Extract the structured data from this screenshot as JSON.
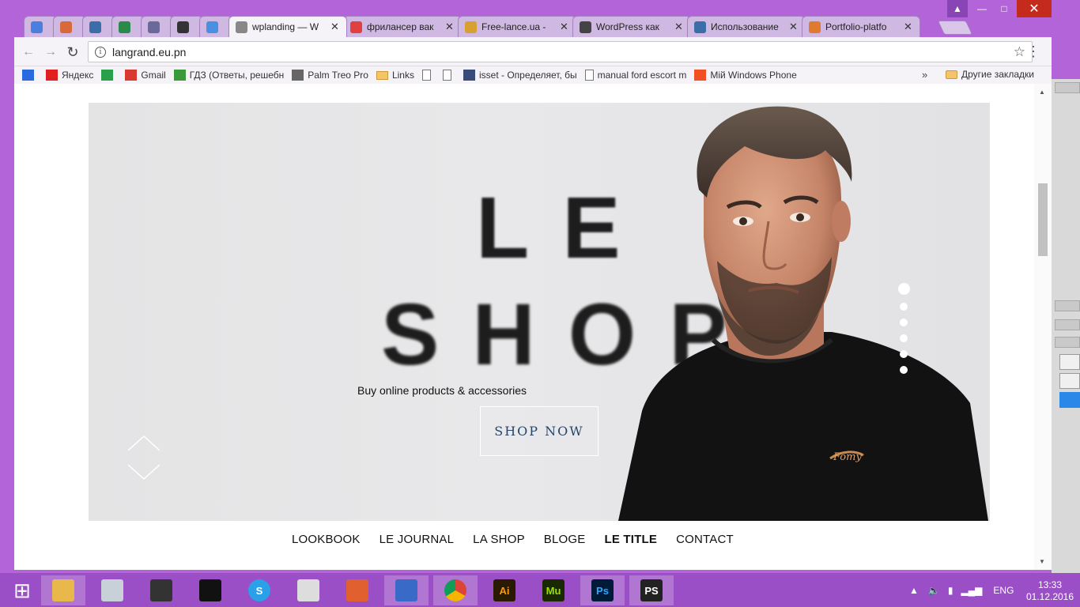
{
  "window": {
    "controls": {
      "user": "▲",
      "minimize": "—",
      "maximize": "□",
      "close": "✕"
    }
  },
  "tabs": [
    {
      "title": "",
      "icon": "google-translate-icon",
      "color": "#4a7fe0"
    },
    {
      "title": "",
      "icon": "app-icon",
      "color": "#d86a3a"
    },
    {
      "title": "",
      "icon": "chart-icon",
      "color": "#3a6ea8"
    },
    {
      "title": "",
      "icon": "f-icon",
      "color": "#2a8a4a"
    },
    {
      "title": "",
      "icon": "tool-icon",
      "color": "#6a6a9a"
    },
    {
      "title": "",
      "icon": "play-icon",
      "color": "#333"
    },
    {
      "title": "",
      "icon": "dashboard-icon",
      "color": "#4a90e2"
    },
    {
      "title": "wplanding — W",
      "icon": "wplanding-icon",
      "color": "#888"
    },
    {
      "title": "фрилансер вак",
      "icon": "yandex-icon",
      "color": "#e04040"
    },
    {
      "title": "Free-lance.ua -",
      "icon": "freelance-icon",
      "color": "#d8a030"
    },
    {
      "title": "WordPress как",
      "icon": "wordpress-icon",
      "color": "#444"
    },
    {
      "title": "Использование",
      "icon": "jb-icon",
      "color": "#3a6ea8"
    },
    {
      "title": "Portfolio-platfo",
      "icon": "portfolio-icon",
      "color": "#e07a30"
    }
  ],
  "toolbar": {
    "back": "←",
    "forward": "→",
    "reload": "↻",
    "url": "langrand.eu.pn",
    "star": "☆",
    "menu": "⋮"
  },
  "bookmarks": [
    {
      "label": "",
      "icon": "mail-icon"
    },
    {
      "label": "Яндекс",
      "icon": "yandex-icon"
    },
    {
      "label": "",
      "icon": "green-mail-icon"
    },
    {
      "label": "Gmail",
      "icon": "gmail-icon"
    },
    {
      "label": "ГДЗ (Ответы, решебн",
      "icon": "gdz-icon"
    },
    {
      "label": "Palm Treo Pro",
      "icon": "cart-icon"
    },
    {
      "label": "Links",
      "icon": "folder-icon"
    },
    {
      "label": "",
      "icon": "page-icon"
    },
    {
      "label": "",
      "icon": "page-icon"
    },
    {
      "label": "isset - Определяет, бы",
      "icon": "php-icon"
    },
    {
      "label": "manual ford escort m",
      "icon": "page-icon"
    },
    {
      "label": "Мій Windows Phone",
      "icon": "windows-icon"
    }
  ],
  "bookmarks_more": "»",
  "bookmarks_other": "Другие закладки",
  "hero": {
    "title_line1": "LE",
    "title_line2": "SHOP",
    "subtitle": "Buy online products & accessories",
    "cta": "SHOP NOW",
    "slides_total": 6,
    "slide_active": 1
  },
  "site_nav": [
    {
      "label": "LOOKBOOK",
      "bold": false
    },
    {
      "label": "LE JOURNAL",
      "bold": false
    },
    {
      "label": "LA SHOP",
      "bold": false
    },
    {
      "label": "BLOGE",
      "bold": false
    },
    {
      "label": "LE TITLE",
      "bold": true
    },
    {
      "label": "CONTACT",
      "bold": false
    }
  ],
  "taskbar": {
    "apps": [
      {
        "name": "start-button",
        "label": "⊞"
      },
      {
        "name": "file-explorer",
        "label": ""
      },
      {
        "name": "monitor-app",
        "label": ""
      },
      {
        "name": "podcast-app",
        "label": ""
      },
      {
        "name": "terminal-app",
        "label": ""
      },
      {
        "name": "skype-app",
        "label": "S"
      },
      {
        "name": "megaphone-app",
        "label": ""
      },
      {
        "name": "paint-app",
        "label": ""
      },
      {
        "name": "save-app",
        "label": ""
      },
      {
        "name": "chrome-app",
        "label": ""
      },
      {
        "name": "illustrator-app",
        "label": "Ai"
      },
      {
        "name": "muse-app",
        "label": "Mu"
      },
      {
        "name": "photoshop-app",
        "label": "Ps"
      },
      {
        "name": "phpstorm-app",
        "label": "PS"
      }
    ],
    "tray": {
      "lang": "ENG",
      "time": "13:33",
      "date": "01.12.2016"
    }
  }
}
